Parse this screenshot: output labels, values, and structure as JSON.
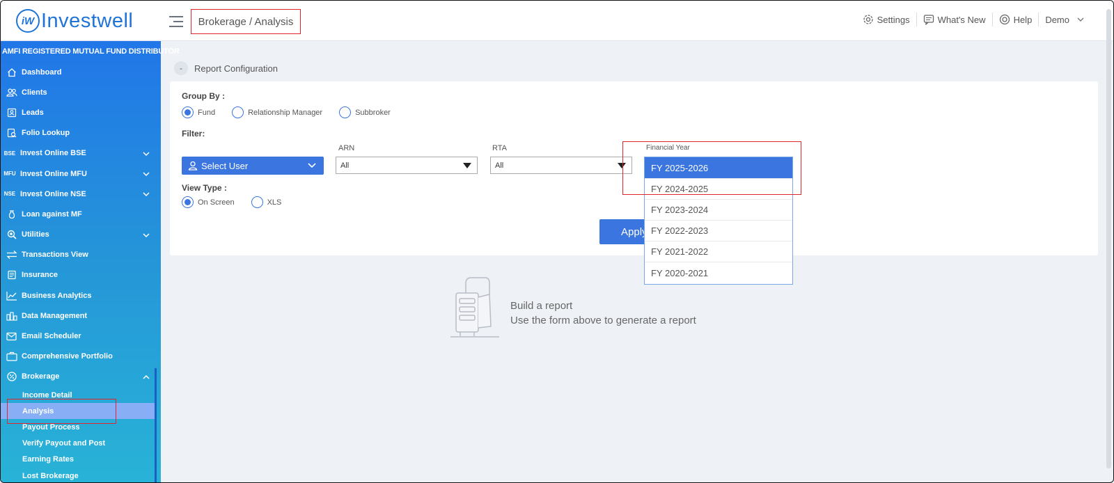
{
  "header": {
    "logo_mark": "iW",
    "logo_text": "Investwell",
    "breadcrumb": "Brokerage / Analysis",
    "settings": "Settings",
    "whats_new": "What's New",
    "help": "Help",
    "user": "Demo"
  },
  "sidebar": {
    "title": "AMFI REGISTERED MUTUAL FUND DISTRIBUTOR",
    "items": [
      {
        "label": "Dashboard",
        "icon": "home-icon"
      },
      {
        "label": "Clients",
        "icon": "users-icon"
      },
      {
        "label": "Leads",
        "icon": "leads-icon"
      },
      {
        "label": "Folio Lookup",
        "icon": "folio-lookup-icon"
      },
      {
        "label": "Invest Online BSE",
        "icon": "BSE",
        "expand": true
      },
      {
        "label": "Invest Online MFU",
        "icon": "MFU",
        "expand": true
      },
      {
        "label": "Invest Online NSE",
        "icon": "NSE",
        "expand": true
      },
      {
        "label": "Loan against MF",
        "icon": "loan-icon"
      },
      {
        "label": "Utilities",
        "icon": "utilities-icon",
        "expand": true
      },
      {
        "label": "Transactions View",
        "icon": "transactions-icon"
      },
      {
        "label": "Insurance",
        "icon": "insurance-icon"
      },
      {
        "label": "Business Analytics",
        "icon": "analytics-icon"
      },
      {
        "label": "Data Management",
        "icon": "data-icon"
      },
      {
        "label": "Email Scheduler",
        "icon": "email-icon"
      },
      {
        "label": "Comprehensive Portfolio",
        "icon": "portfolio-icon"
      },
      {
        "label": "Brokerage",
        "icon": "percent-icon",
        "expanded": true
      }
    ],
    "brokerage_sub": [
      "Income Detail",
      "Analysis",
      "Payout Process",
      "Verify Payout and Post",
      "Earning Rates",
      "Lost Brokerage"
    ],
    "active_sub": "Analysis"
  },
  "main": {
    "section_toggle": "-",
    "section_title": "Report Configuration",
    "group_by_label": "Group By :",
    "group_by_options": [
      "Fund",
      "Relationship Manager",
      "Subbroker"
    ],
    "group_by_selected": "Fund",
    "filter_label": "Filter:",
    "select_user": "Select User",
    "arn_label": "ARN",
    "arn_value": "All",
    "rta_label": "RTA",
    "rta_value": "All",
    "fy_label": "Financial Year",
    "view_type_label": "View Type :",
    "view_type_options": [
      "On Screen",
      "XLS"
    ],
    "view_type_selected": "On Screen",
    "apply_label": "Apply",
    "fy_options": [
      "FY 2025-2026",
      "FY 2024-2025",
      "FY 2023-2024",
      "FY 2022-2023",
      "FY 2021-2022",
      "FY 2020-2021"
    ],
    "fy_selected": "FY 2025-2026",
    "empty_title": "Build a report",
    "empty_subtitle": "Use the form above to generate a report"
  },
  "colors": {
    "brand": "#1f74d6",
    "primary_button": "#3a75e0",
    "highlight_box": "#e0262c",
    "active_sub": "#88aef6"
  }
}
